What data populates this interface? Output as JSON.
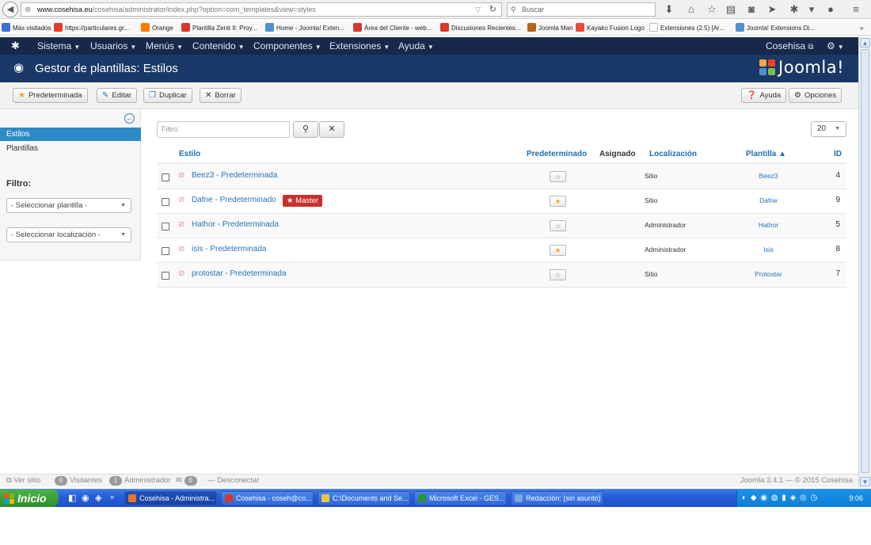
{
  "browser": {
    "url_domain": "www.cosehisa.eu",
    "url_rest": "/cosehisa/administrator/index.php?option=com_templates&view=styles",
    "search_placeholder": "Buscar",
    "bookmarks": [
      {
        "label": "Más visitados",
        "color": "#3a6fd8"
      },
      {
        "label": "https://particulares.gr...",
        "color": "#e53b2c"
      },
      {
        "label": "Orange",
        "color": "#ff7900"
      },
      {
        "label": "Plantilla Zenit II: Proy...",
        "color": "#d43a2f"
      },
      {
        "label": "Home - Joomla! Exten...",
        "color": "#5091cd"
      },
      {
        "label": "Área del Cliente - web...",
        "color": "#d43a2f"
      },
      {
        "label": "Discusiones Recientes...",
        "color": "#d43a2f"
      },
      {
        "label": "Joomla Man",
        "color": "#b5651d"
      },
      {
        "label": "Kayako Fusion Logo",
        "color": "#e84a3c"
      },
      {
        "label": "Extensiones (2.5) [Ar...",
        "color": "#cccccc"
      },
      {
        "label": "Joomla! Extensions Di...",
        "color": "#5091cd"
      }
    ]
  },
  "topnav": {
    "items": [
      "Sistema",
      "Usuarios",
      "Menús",
      "Contenido",
      "Componentes",
      "Extensiones",
      "Ayuda"
    ],
    "user": "Cosehisa"
  },
  "header": {
    "title": "Gestor de plantillas: Estilos",
    "brand": "Joomla!"
  },
  "toolbar": {
    "default_label": "Predeterminada",
    "edit_label": "Editar",
    "duplicate_label": "Duplicar",
    "delete_label": "Borrar",
    "help_label": "Ayuda",
    "options_label": "Opciones"
  },
  "sidebar": {
    "items": [
      "Estilos",
      "Plantillas"
    ],
    "filter_title": "Filtro:",
    "select_template": "- Seleccionar plantilla -",
    "select_location": "- Seleccionar localización -"
  },
  "filter": {
    "placeholder": "Filtro:",
    "limit": "20"
  },
  "table": {
    "headers": {
      "style": "Estilo",
      "default": "Predeterminado",
      "assigned": "Asignado",
      "location": "Localización",
      "template": "Plantilla ▲",
      "id": "ID"
    },
    "master_label": "Master",
    "rows": [
      {
        "style": "Beez3 - Predeterminada",
        "default": false,
        "location": "Sitio",
        "template": "Beez3",
        "id": "4",
        "master": false
      },
      {
        "style": "Dafne - Predeterminado",
        "default": true,
        "location": "Sitio",
        "template": "Dafne",
        "id": "9",
        "master": true
      },
      {
        "style": "Hathor - Predeterminada",
        "default": false,
        "location": "Administrador",
        "template": "Hathor",
        "id": "5",
        "master": false
      },
      {
        "style": "isis - Predeterminada",
        "default": true,
        "location": "Administrador",
        "template": "Isis",
        "id": "8",
        "master": false
      },
      {
        "style": "protostar - Predeterminada",
        "default": false,
        "location": "Sitio",
        "template": "Protostar",
        "id": "7",
        "master": false
      }
    ]
  },
  "status": {
    "view_site": "Ver sitio",
    "visitors_count": "0",
    "visitors_label": "Visitantes",
    "admins_count": "1",
    "admins_label": "Administrador",
    "messages_count": "0",
    "logout": "Desconectar",
    "version": "Joomla 3.4.1 — © 2015 Cosehisa"
  },
  "taskbar": {
    "start_label": "Inicio",
    "tasks": [
      {
        "label": "Cosehisa - Administra...",
        "color": "#e8762c"
      },
      {
        "label": "Cosehisa - coseh@co...",
        "color": "#d03a2a"
      },
      {
        "label": "C:\\Documents and Se...",
        "color": "#f0c640"
      },
      {
        "label": "Microsoft Excel - GES...",
        "color": "#2e8f3a"
      },
      {
        "label": "Redacción: (sin asunto)",
        "color": "#7aa7e0"
      }
    ],
    "clock": "9:06"
  }
}
